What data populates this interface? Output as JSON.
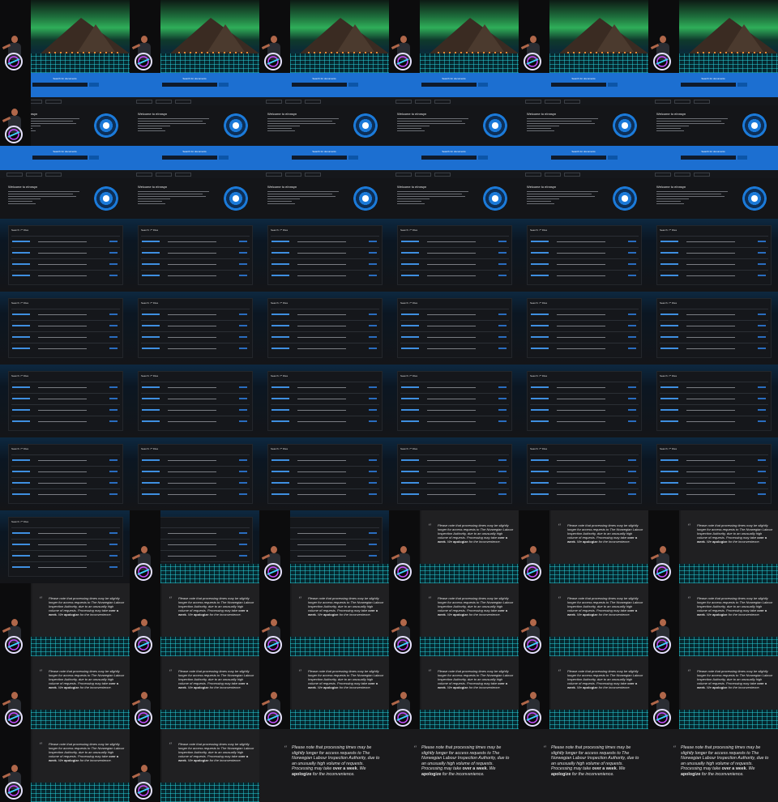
{
  "colors": {
    "site_blue": "#1c6fd1",
    "dark_bg": "#141518",
    "aurora_green": "#2fae59",
    "grid_cyan": "#28d2dc",
    "link_blue": "#3f8fe0"
  },
  "site": {
    "header_title": "Search for documents",
    "welcome_title": "Welcome to eInnsyn",
    "table_title": "Search: 7* Files"
  },
  "notice": {
    "quote_mark": "“",
    "text_before": "Please note that processing times may be slightly longer for access requests to The Norwegian Labour Inspection Authority, due to an unusually high volume of requests. Processing may take ",
    "bold_1": "over a week",
    "text_mid": ". We ",
    "bold_2": "apologize",
    "text_after": " for the inconvenience."
  },
  "frames": [
    "aurora",
    "aurora",
    "aurora",
    "aurora",
    "aurora",
    "aurora",
    "site-overlay",
    "site",
    "site",
    "site",
    "site",
    "site",
    "site",
    "site",
    "site",
    "site",
    "site",
    "site",
    "table",
    "table",
    "table",
    "table",
    "table",
    "table",
    "table",
    "table",
    "table",
    "table",
    "table",
    "table",
    "table",
    "table",
    "table",
    "table",
    "table",
    "table",
    "table",
    "table",
    "table",
    "table",
    "table",
    "table",
    "table",
    "table-overlay",
    "table-overlay",
    "notice-overlay",
    "notice-overlay",
    "notice-overlay",
    "notice-overlay",
    "notice-overlay",
    "notice-overlay",
    "notice-overlay",
    "notice-overlay",
    "notice-overlay",
    "notice-overlay",
    "notice-overlay",
    "notice-overlay",
    "notice-overlay",
    "notice-overlay",
    "notice-overlay",
    "notice-overlay",
    "notice-overlay",
    "notice-full",
    "notice-full",
    "notice-full",
    "notice-full"
  ]
}
